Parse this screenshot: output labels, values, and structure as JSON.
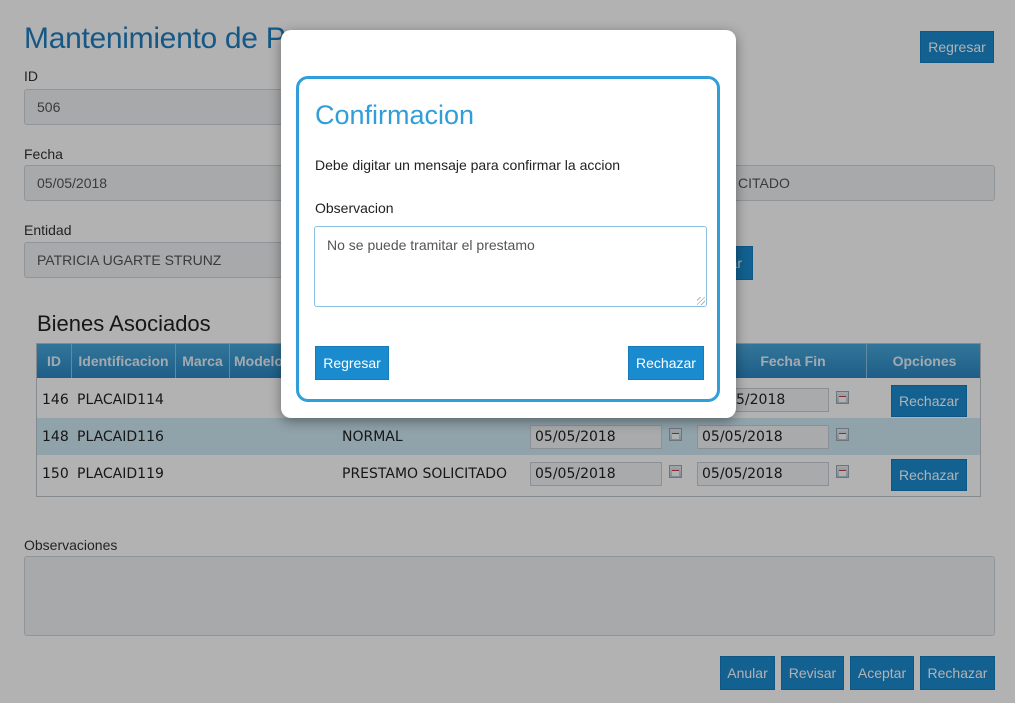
{
  "page": {
    "title": "Mantenimiento de Pr",
    "back_top_label": "Regresar",
    "id_label": "ID",
    "id_value": "506",
    "fecha_label": "Fecha",
    "fecha_value": "05/05/2018",
    "estado_value_partial": "CITADO",
    "entidad_label": "Entidad",
    "entidad_value": "PATRICIA UGARTE STRUNZ",
    "hidden_button_partial": "ar",
    "section_title": "Bienes Asociados"
  },
  "table": {
    "headers": {
      "id": "ID",
      "identificacion": "Identificacion",
      "marca": "Marca",
      "modelo": "Modelo",
      "fecha_fin": "Fecha Fin",
      "opciones": "Opciones"
    },
    "rows": [
      {
        "id": "146",
        "identificacion": "PLACAID114",
        "estado": "",
        "fecha_inicio": "",
        "fecha_fin": "5/2018",
        "action": "Rechazar"
      },
      {
        "id": "148",
        "identificacion": "PLACAID116",
        "estado": "NORMAL",
        "fecha_inicio": "05/05/2018",
        "fecha_fin": "05/05/2018",
        "action": ""
      },
      {
        "id": "150",
        "identificacion": "PLACAID119",
        "estado": "PRESTAMO SOLICITADO",
        "fecha_inicio": "05/05/2018",
        "fecha_fin": "05/05/2018",
        "action": "Rechazar"
      }
    ]
  },
  "observaciones": {
    "label": "Observaciones",
    "value": ""
  },
  "footer": {
    "anular": "Anular",
    "revisar": "Revisar",
    "aceptar": "Aceptar",
    "rechazar": "Rechazar"
  },
  "modal": {
    "title": "Confirmacion",
    "message": "Debe digitar un mensaje para confirmar la accion",
    "obs_label": "Observacion",
    "obs_value": "No se puede tramitar el prestamo",
    "back_label": "Regresar",
    "reject_label": "Rechazar"
  },
  "colors": {
    "accent": "#1b8bd0",
    "title": "#1f7fc0",
    "header": "#2b86c4",
    "alt_row": "#cfe8f4",
    "modal_border": "#2f9ed9"
  }
}
